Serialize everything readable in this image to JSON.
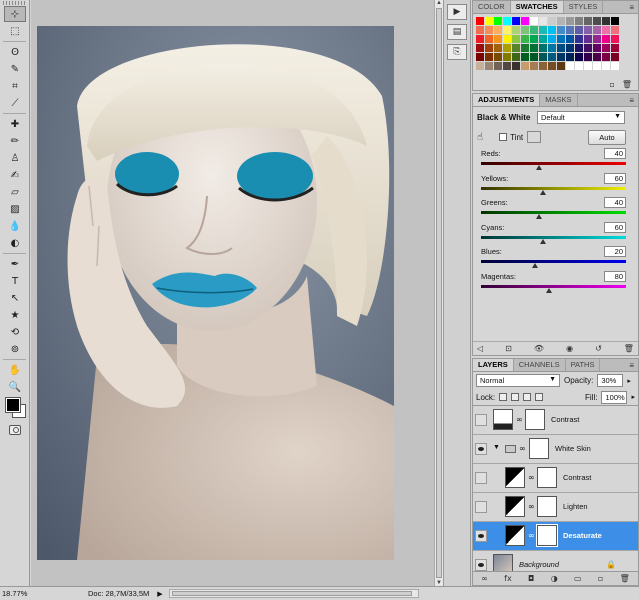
{
  "colors": {
    "accent_selected": "#3c8ee6",
    "eyeshadow": "#1a8eb0",
    "background_photo": "#6b7688"
  },
  "tools": [
    {
      "name": "move-tool",
      "glyph": "⊹"
    },
    {
      "name": "marquee-tool",
      "glyph": "⬚"
    },
    {
      "name": "lasso-tool",
      "glyph": "ʘ"
    },
    {
      "name": "quick-selection-tool",
      "glyph": "✎"
    },
    {
      "name": "crop-tool",
      "glyph": "⌗"
    },
    {
      "name": "eyedropper-tool",
      "glyph": "⟋"
    },
    {
      "name": "healing-brush-tool",
      "glyph": "✚"
    },
    {
      "name": "brush-tool",
      "glyph": "✏"
    },
    {
      "name": "clone-stamp-tool",
      "glyph": "♙"
    },
    {
      "name": "history-brush-tool",
      "glyph": "✍"
    },
    {
      "name": "eraser-tool",
      "glyph": "▱"
    },
    {
      "name": "gradient-tool",
      "glyph": "▨"
    },
    {
      "name": "blur-tool",
      "glyph": "💧"
    },
    {
      "name": "dodge-tool",
      "glyph": "◐"
    },
    {
      "name": "pen-tool",
      "glyph": "✒"
    },
    {
      "name": "type-tool",
      "glyph": "T"
    },
    {
      "name": "path-selection-tool",
      "glyph": "↖"
    },
    {
      "name": "shape-tool",
      "glyph": "★"
    },
    {
      "name": "3d-rotate-tool",
      "glyph": "⟲"
    },
    {
      "name": "3d-orbit-tool",
      "glyph": "⊚"
    },
    {
      "name": "hand-tool",
      "glyph": "✋"
    },
    {
      "name": "zoom-tool",
      "glyph": "🔍"
    }
  ],
  "swatches": {
    "tabs": [
      "COLOR",
      "SWATCHES",
      "STYLES"
    ]
  },
  "adjustments": {
    "tabs": [
      "ADJUSTMENTS",
      "MASKS"
    ],
    "title": "Black & White",
    "preset": "Default",
    "tint_label": "Tint",
    "auto_label": "Auto",
    "sliders": [
      {
        "label": "Reds:",
        "value": "40",
        "fraction": 0.4,
        "gradient": "linear-gradient(90deg,#300,#e00)"
      },
      {
        "label": "Yellows:",
        "value": "60",
        "fraction": 0.43,
        "gradient": "linear-gradient(90deg,#330,#ee0)"
      },
      {
        "label": "Greens:",
        "value": "40",
        "fraction": 0.4,
        "gradient": "linear-gradient(90deg,#030,#0d0)"
      },
      {
        "label": "Cyans:",
        "value": "60",
        "fraction": 0.43,
        "gradient": "linear-gradient(90deg,#033,#0dd)"
      },
      {
        "label": "Blues:",
        "value": "20",
        "fraction": 0.37,
        "gradient": "linear-gradient(90deg,#003,#00e)"
      },
      {
        "label": "Magentas:",
        "value": "80",
        "fraction": 0.47,
        "gradient": "linear-gradient(90deg,#303,#e0e)"
      }
    ]
  },
  "layers_panel": {
    "tabs": [
      "LAYERS",
      "CHANNELS",
      "PATHS"
    ],
    "blend_mode": "Normal",
    "opacity_label": "Opacity:",
    "opacity_value": "30%",
    "lock_label": "Lock:",
    "fill_label": "Fill:",
    "fill_value": "100%",
    "layers": [
      {
        "name": "Contrast",
        "visible": false,
        "indent": 0,
        "type": "adjustment-levels",
        "selected": false
      },
      {
        "name": "White Skin",
        "visible": true,
        "indent": 0,
        "type": "group",
        "selected": false
      },
      {
        "name": "Contrast",
        "visible": false,
        "indent": 1,
        "type": "adjustment",
        "selected": false
      },
      {
        "name": "Lighten",
        "visible": false,
        "indent": 1,
        "type": "adjustment",
        "selected": false
      },
      {
        "name": "Desaturate",
        "visible": true,
        "indent": 1,
        "type": "adjustment",
        "selected": true
      },
      {
        "name": "Background",
        "visible": true,
        "indent": 0,
        "type": "image",
        "selected": false,
        "locked": true
      }
    ]
  },
  "status": {
    "zoom": "18.77%",
    "doc": "Doc: 28,7M/33,5M"
  }
}
